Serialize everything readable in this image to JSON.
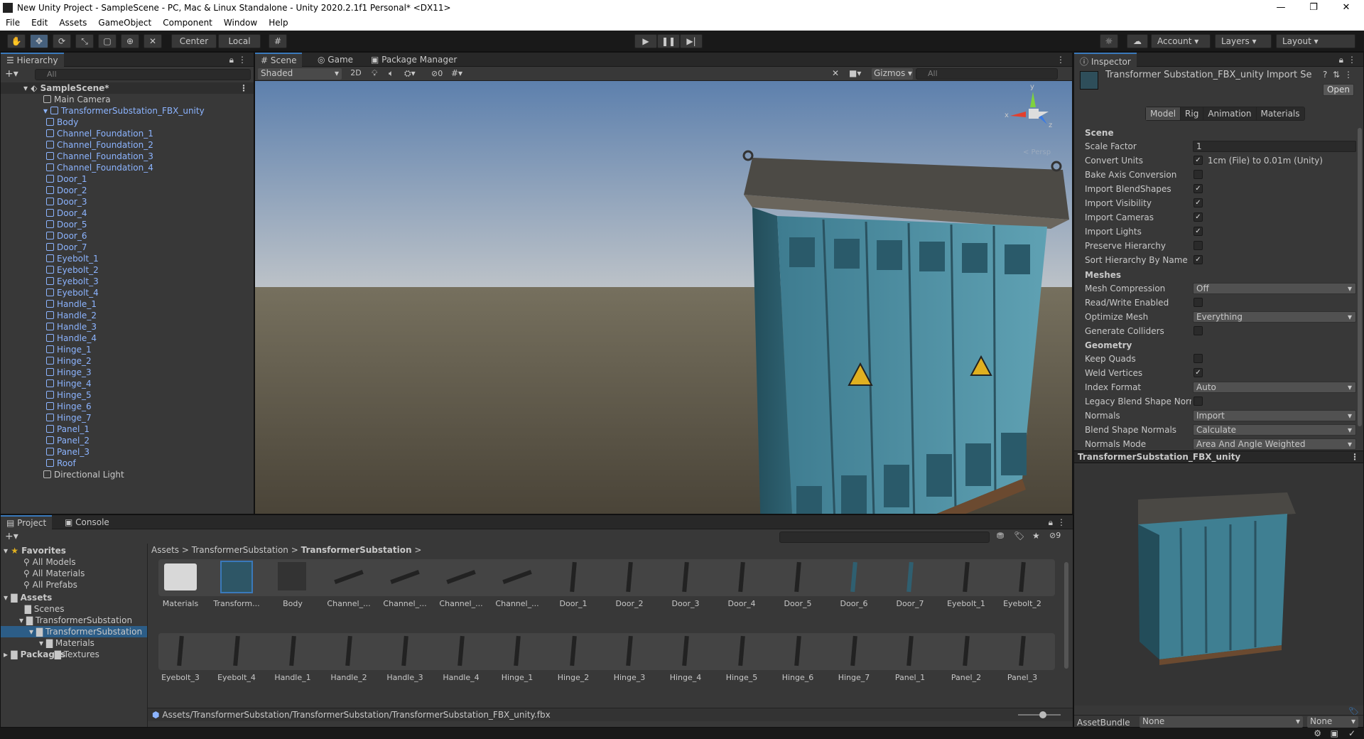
{
  "window": {
    "title": "New Unity Project - SampleScene - PC, Mac & Linux Standalone - Unity 2020.2.1f1 Personal* <DX11>"
  },
  "menu": [
    "File",
    "Edit",
    "Assets",
    "GameObject",
    "Component",
    "Window",
    "Help"
  ],
  "toolbar": {
    "center": "Center",
    "local": "Local",
    "account": "Account",
    "layers": "Layers",
    "layout": "Layout"
  },
  "hierarchy": {
    "tab": "Hierarchy",
    "search_placeholder": "All",
    "scene": "SampleScene*",
    "items": [
      {
        "label": "Main Camera",
        "indent": 1,
        "blue": false
      },
      {
        "label": "TransformerSubstation_FBX_unity",
        "indent": 1,
        "blue": true
      },
      {
        "label": "Body",
        "indent": 2,
        "blue": true
      },
      {
        "label": "Channel_Foundation_1",
        "indent": 2,
        "blue": true
      },
      {
        "label": "Channel_Foundation_2",
        "indent": 2,
        "blue": true
      },
      {
        "label": "Channel_Foundation_3",
        "indent": 2,
        "blue": true
      },
      {
        "label": "Channel_Foundation_4",
        "indent": 2,
        "blue": true
      },
      {
        "label": "Door_1",
        "indent": 2,
        "blue": true
      },
      {
        "label": "Door_2",
        "indent": 2,
        "blue": true
      },
      {
        "label": "Door_3",
        "indent": 2,
        "blue": true
      },
      {
        "label": "Door_4",
        "indent": 2,
        "blue": true
      },
      {
        "label": "Door_5",
        "indent": 2,
        "blue": true
      },
      {
        "label": "Door_6",
        "indent": 2,
        "blue": true
      },
      {
        "label": "Door_7",
        "indent": 2,
        "blue": true
      },
      {
        "label": "Eyebolt_1",
        "indent": 2,
        "blue": true
      },
      {
        "label": "Eyebolt_2",
        "indent": 2,
        "blue": true
      },
      {
        "label": "Eyebolt_3",
        "indent": 2,
        "blue": true
      },
      {
        "label": "Eyebolt_4",
        "indent": 2,
        "blue": true
      },
      {
        "label": "Handle_1",
        "indent": 2,
        "blue": true
      },
      {
        "label": "Handle_2",
        "indent": 2,
        "blue": true
      },
      {
        "label": "Handle_3",
        "indent": 2,
        "blue": true
      },
      {
        "label": "Handle_4",
        "indent": 2,
        "blue": true
      },
      {
        "label": "Hinge_1",
        "indent": 2,
        "blue": true
      },
      {
        "label": "Hinge_2",
        "indent": 2,
        "blue": true
      },
      {
        "label": "Hinge_3",
        "indent": 2,
        "blue": true
      },
      {
        "label": "Hinge_4",
        "indent": 2,
        "blue": true
      },
      {
        "label": "Hinge_5",
        "indent": 2,
        "blue": true
      },
      {
        "label": "Hinge_6",
        "indent": 2,
        "blue": true
      },
      {
        "label": "Hinge_7",
        "indent": 2,
        "blue": true
      },
      {
        "label": "Panel_1",
        "indent": 2,
        "blue": true
      },
      {
        "label": "Panel_2",
        "indent": 2,
        "blue": true
      },
      {
        "label": "Panel_3",
        "indent": 2,
        "blue": true
      },
      {
        "label": "Roof",
        "indent": 2,
        "blue": true
      },
      {
        "label": "Directional Light",
        "indent": 1,
        "blue": false
      }
    ]
  },
  "scene": {
    "tabs": [
      "Scene",
      "Game",
      "Package Manager"
    ],
    "shading": "Shaded",
    "mode2d": "2D",
    "hidden_count": "0",
    "gizmos": "Gizmos",
    "search_placeholder": "All",
    "axis_x": "x",
    "axis_y": "y",
    "axis_z": "z",
    "persp": "< Persp"
  },
  "inspector": {
    "tab": "Inspector",
    "title": "Transformer Substation_FBX_unity Import Settir",
    "open": "Open",
    "subtabs": [
      "Model",
      "Rig",
      "Animation",
      "Materials"
    ],
    "sections": {
      "scene": "Scene",
      "meshes": "Meshes",
      "geometry": "Geometry"
    },
    "rows": [
      {
        "label": "Scale Factor",
        "type": "text",
        "value": "1"
      },
      {
        "label": "Convert Units",
        "type": "check",
        "checked": true,
        "value": "1cm (File) to 0.01m (Unity)"
      },
      {
        "label": "Bake Axis Conversion",
        "type": "check",
        "checked": false
      },
      {
        "label": "Import BlendShapes",
        "type": "check",
        "checked": true
      },
      {
        "label": "Import Visibility",
        "type": "check",
        "checked": true
      },
      {
        "label": "Import Cameras",
        "type": "check",
        "checked": true
      },
      {
        "label": "Import Lights",
        "type": "check",
        "checked": true
      },
      {
        "label": "Preserve Hierarchy",
        "type": "check",
        "checked": false
      },
      {
        "label": "Sort Hierarchy By Name",
        "type": "check",
        "checked": true
      },
      {
        "label": "Mesh Compression",
        "type": "drop",
        "value": "Off"
      },
      {
        "label": "Read/Write Enabled",
        "type": "check",
        "checked": false
      },
      {
        "label": "Optimize Mesh",
        "type": "drop",
        "value": "Everything"
      },
      {
        "label": "Generate Colliders",
        "type": "check",
        "checked": false
      },
      {
        "label": "Keep Quads",
        "type": "check",
        "checked": false
      },
      {
        "label": "Weld Vertices",
        "type": "check",
        "checked": true
      },
      {
        "label": "Index Format",
        "type": "drop",
        "value": "Auto"
      },
      {
        "label": "Legacy Blend Shape Norr",
        "type": "check",
        "checked": false
      },
      {
        "label": "Normals",
        "type": "drop",
        "value": "Import"
      },
      {
        "label": "Blend Shape Normals",
        "type": "drop",
        "value": "Calculate"
      },
      {
        "label": "Normals Mode",
        "type": "drop",
        "value": "Area And Angle Weighted"
      }
    ],
    "preview_title": "TransformerSubstation_FBX_unity",
    "assetbundle_label": "AssetBundle",
    "assetbundle_value": "None",
    "assetbundle_variant": "None"
  },
  "project": {
    "tabs": [
      "Project",
      "Console"
    ],
    "hidden_count": "9",
    "favorites": "Favorites",
    "fav_items": [
      "All Models",
      "All Materials",
      "All Prefabs"
    ],
    "assets": "Assets",
    "folders": [
      {
        "label": "Scenes",
        "indent": 2
      },
      {
        "label": "TransformerSubstation",
        "indent": 2
      },
      {
        "label": "TransformerSubstation",
        "indent": 3,
        "sel": true
      },
      {
        "label": "Materials",
        "indent": 4
      },
      {
        "label": "Textures",
        "indent": 5
      }
    ],
    "packages": "Packages",
    "breadcrumb": [
      "Assets",
      "TransformerSubstation",
      "TransformerSubstation"
    ],
    "row1": [
      "Materials",
      "Transform...",
      "Body",
      "Channel_...",
      "Channel_...",
      "Channel_...",
      "Channel_...",
      "Door_1",
      "Door_2",
      "Door_3",
      "Door_4",
      "Door_5",
      "Door_6",
      "Door_7",
      "Eyebolt_1",
      "Eyebolt_2"
    ],
    "row2": [
      "Eyebolt_3",
      "Eyebolt_4",
      "Handle_1",
      "Handle_2",
      "Handle_3",
      "Handle_4",
      "Hinge_1",
      "Hinge_2",
      "Hinge_3",
      "Hinge_4",
      "Hinge_5",
      "Hinge_6",
      "Hinge_7",
      "Panel_1",
      "Panel_2",
      "Panel_3"
    ],
    "path": "Assets/TransformerSubstation/TransformerSubstation/TransformerSubstation_FBX_unity.fbx"
  }
}
